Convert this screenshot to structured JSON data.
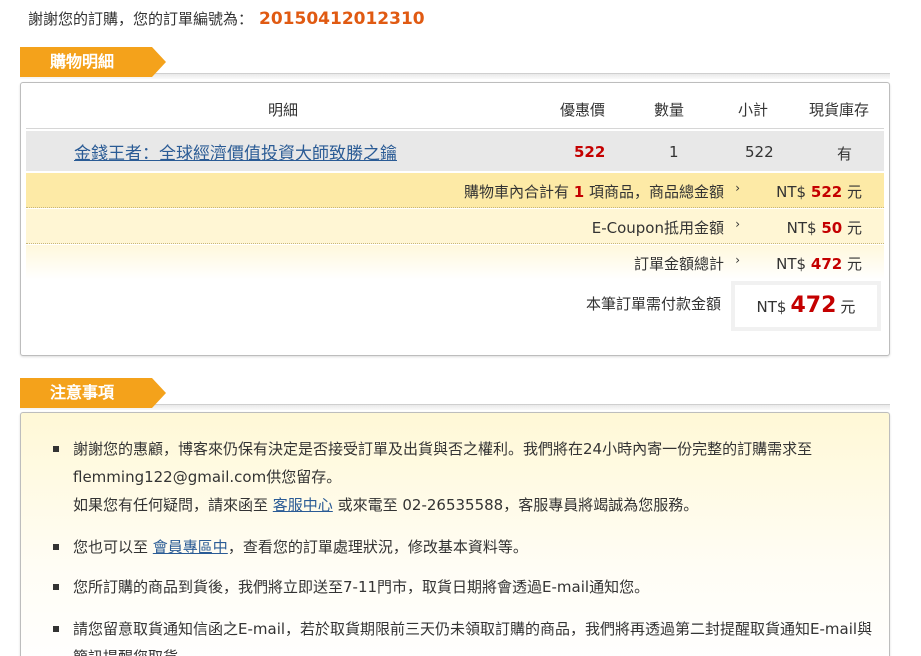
{
  "thanks": {
    "text": "謝謝您的訂購，您的訂單編號為：",
    "order_no": "20150412012310"
  },
  "detail_section": {
    "title": "購物明細"
  },
  "columns": {
    "detail": "明細",
    "price": "優惠價",
    "qty": "數量",
    "subtotal": "小計",
    "stock": "現貨庫存"
  },
  "item": {
    "title": "金錢王者：全球經濟價值投資大師致勝之鑰",
    "price": "522",
    "qty": "1",
    "subtotal": "522",
    "stock": "有"
  },
  "summary": {
    "total_prefix": "購物車內合計有",
    "total_count": "1",
    "total_suffix": "項商品，商品總金額",
    "total_currency": "NT$",
    "total_value": "522",
    "total_unit": "元",
    "coupon_label": "E-Coupon抵用金額",
    "coupon_currency": "NT$",
    "coupon_value": "50",
    "coupon_unit": "元",
    "order_label": "訂單金額總計",
    "order_currency": "NT$",
    "order_value": "472",
    "order_unit": "元",
    "arrow": "›",
    "pay_label": "本筆訂單需付款金額",
    "pay_currency": "NT$",
    "pay_value": "472",
    "pay_unit": "元"
  },
  "notice_section": {
    "title": "注意事項"
  },
  "notices": {
    "n1_a": "謝謝您的惠顧，博客來仍保有決定是否接受訂單及出貨與否之權利。我們將在24小時內寄一份完整的訂購需求至flemming122@gmail.com供您留存。",
    "n1_b": "如果您有任何疑問，請來函至",
    "n1_link": "客服中心",
    "n1_c": "或來電至 02-26535588，客服專員將竭誠為您服務。",
    "n2_a": "您也可以至",
    "n2_link": "會員專區中",
    "n2_b": "，查看您的訂單處理狀況，修改基本資料等。",
    "n3": "您所訂購的商品到貨後，我們將立即送至7-11門市，取貨日期將會透過E-mail通知您。",
    "n4": "請您留意取貨通知信函之E-mail，若於取貨期限前三天仍未領取訂購的商品，我們將再透過第二封提醒取貨通知E-mail與簡訊提醒您取貨。"
  }
}
